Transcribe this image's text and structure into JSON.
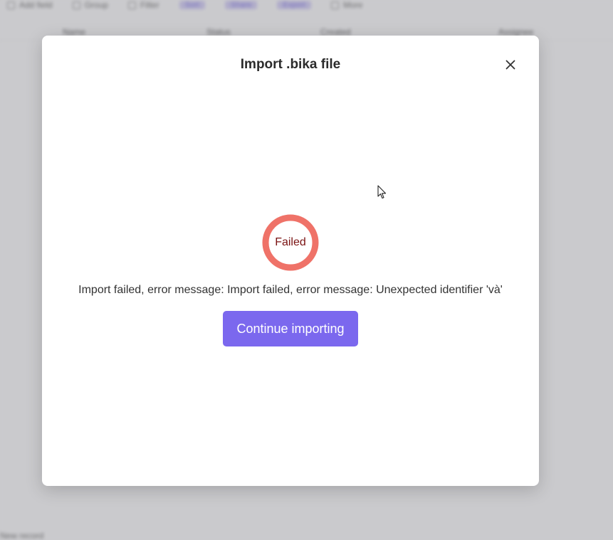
{
  "background": {
    "toolbar": {
      "items": [
        "Add field",
        "Group",
        "Filter",
        "Sort",
        "Share",
        "Export",
        "More"
      ]
    },
    "header": {
      "columns": [
        "Name",
        "Status",
        "Created",
        "Assignee"
      ]
    },
    "footer_text": "New record"
  },
  "modal": {
    "title": "Import .bika file",
    "close_icon": "close-icon",
    "status": {
      "label": "Failed",
      "ring_color": "#ef7268",
      "text_color": "#7a1212"
    },
    "error_message": "Import failed, error message: Import failed, error message: Unexpected identifier 'và'",
    "continue_label": "Continue importing",
    "accent": "#7b68ee"
  }
}
